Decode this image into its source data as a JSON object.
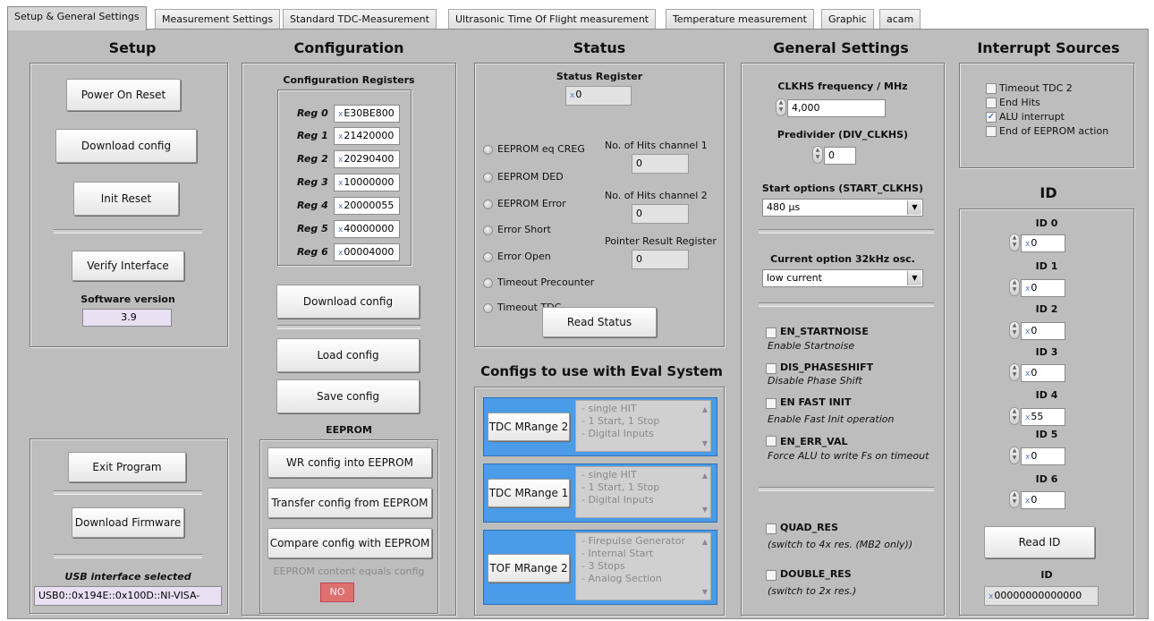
{
  "tabs": [
    "Setup & General Settings",
    "Measurement Settings",
    "Standard TDC-Measurement",
    "Ultrasonic Time Of Flight measurement",
    "Temperature measurement",
    "Graphic",
    "acam"
  ],
  "setup": {
    "heading": "Setup",
    "power_on_reset": "Power On Reset",
    "download_config": "Download config",
    "init_reset": "Init Reset",
    "verify_interface": "Verify Interface",
    "software_version_label": "Software version",
    "software_version": "3.9",
    "exit_program": "Exit Program",
    "download_firmware": "Download Firmware",
    "usb_label": "USB interface selected",
    "usb_value": "USB0::0x194E::0x100D::NI-VISA-"
  },
  "configuration": {
    "heading": "Configuration",
    "registers_title": "Configuration Registers",
    "registers": [
      {
        "label": "Reg 0",
        "value": "E30BE800"
      },
      {
        "label": "Reg 1",
        "value": "21420000"
      },
      {
        "label": "Reg 2",
        "value": "20290400"
      },
      {
        "label": "Reg 3",
        "value": "10000000"
      },
      {
        "label": "Reg 4",
        "value": "20000055"
      },
      {
        "label": "Reg 5",
        "value": "40000000"
      },
      {
        "label": "Reg 6",
        "value": "00004000"
      }
    ],
    "radix": "x",
    "download_config": "Download config",
    "load_config": "Load config",
    "save_config": "Save config",
    "eeprom_title": "EEPROM",
    "wr_config": "WR config into EEPROM",
    "transfer_config": "Transfer config from EEPROM",
    "compare_config": "Compare config with EEPROM",
    "eeprom_equals_label": "EEPROM content equals config",
    "eeprom_equals_value": "NO"
  },
  "status": {
    "heading": "Status",
    "register_title": "Status Register",
    "register_value": "0",
    "flags": [
      "EEPROM eq CREG",
      "EEPROM DED",
      "EEPROM Error",
      "Error Short",
      "Error Open",
      "Timeout Precounter",
      "Timeout TDC"
    ],
    "hits1_label": "No. of Hits channel 1",
    "hits1_value": "0",
    "hits2_label": "No. of Hits channel 2",
    "hits2_value": "0",
    "pointer_label": "Pointer Result Register",
    "pointer_value": "0",
    "read_status": "Read Status"
  },
  "eval_configs": {
    "heading": "Configs to use with Eval System",
    "items": [
      {
        "button": "TDC MRange 2",
        "lines": [
          "- single HIT",
          "- 1 Start, 1 Stop",
          "- Digital Inputs"
        ]
      },
      {
        "button": "TDC MRange 1",
        "lines": [
          "- single HIT",
          "- 1 Start, 1 Stop",
          "- Digital Inputs"
        ]
      },
      {
        "button": "TOF MRange 2",
        "lines": [
          "- Firepulse Generator",
          "- Internal Start",
          "- 3 Stops",
          "- Analog Section"
        ]
      }
    ]
  },
  "general": {
    "heading": "General Settings",
    "clkhs_label": "CLKHS frequency / MHz",
    "clkhs_value": "4,000",
    "predivider_label": "Predivider (DIV_CLKHS)",
    "predivider_value": "0",
    "start_options_label": "Start options (START_CLKHS)",
    "start_options_value": "480 µs",
    "current_option_label": "Current option 32kHz osc.",
    "current_option_value": "low current",
    "options": [
      {
        "name": "EN_STARTNOISE",
        "desc": "Enable Startnoise",
        "checked": false
      },
      {
        "name": "DIS_PHASESHIFT",
        "desc": "Disable Phase Shift",
        "checked": false
      },
      {
        "name": "EN FAST INIT",
        "desc": "Enable Fast Init operation",
        "checked": false
      },
      {
        "name": "EN_ERR_VAL",
        "desc": "Force ALU to write Fs on timeout",
        "checked": false
      }
    ],
    "quad_res": "QUAD_RES",
    "quad_res_desc": "(switch to 4x res. (MB2 only))",
    "double_res": "DOUBLE_RES",
    "double_res_desc": "(switch to 2x res.)"
  },
  "interrupts": {
    "heading": "Interrupt Sources",
    "items": [
      {
        "label": "Timeout TDC 2",
        "checked": false
      },
      {
        "label": "End Hits",
        "checked": false
      },
      {
        "label": "ALU interrupt",
        "checked": true
      },
      {
        "label": "End of EEPROM action",
        "checked": false
      }
    ]
  },
  "id": {
    "heading": "ID",
    "items": [
      {
        "label": "ID 0",
        "value": "0"
      },
      {
        "label": "ID 1",
        "value": "0"
      },
      {
        "label": "ID 2",
        "value": "0"
      },
      {
        "label": "ID 3",
        "value": "0"
      },
      {
        "label": "ID 4",
        "value": "55"
      },
      {
        "label": "ID 5",
        "value": "0"
      },
      {
        "label": "ID 6",
        "value": "0"
      }
    ],
    "read_id": "Read ID",
    "result_label": "ID",
    "result_value": "00000000000000"
  },
  "colors": {
    "panel": "#bdbdbd",
    "eval_box": "#4a9be8",
    "no_indicator": "#e07070",
    "version_field": "#e9e0f4"
  }
}
